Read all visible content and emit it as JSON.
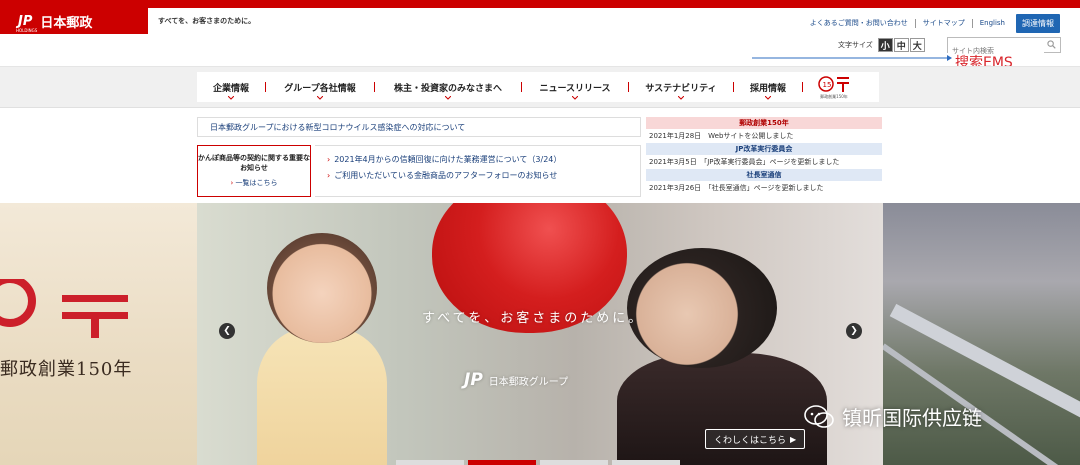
{
  "header": {
    "logo_jp": "JP",
    "logo_name": "日本郵政",
    "logo_sub": "HOLDINGS",
    "tagline": "すべてを、お客さまのために。",
    "utility_links": [
      "よくあるご質問・お問い合わせ",
      "サイトマップ",
      "English"
    ],
    "procure_label": "調達情報",
    "fontsize_label": "文字サイズ",
    "fontsize_options": [
      "小",
      "中",
      "大"
    ],
    "search_placeholder": "サイト内検索"
  },
  "annotation": {
    "text": "搜索EMS",
    "color": "#d9262c"
  },
  "nav": {
    "items": [
      "企業情報",
      "グループ各社情報",
      "株主・投資家のみなさまへ",
      "ニュースリリース",
      "サステナビリティ",
      "採用情報"
    ],
    "anniv_caption": "郵政創業150年"
  },
  "notices": {
    "covid": "日本郵政グループにおける新型コロナウイルス感染症への対応について",
    "important_title": "かんぽ商品等の契約に関する重要なお知らせ",
    "important_more": "一覧はこちら",
    "links": [
      "2021年4月からの信頼回復に向けた業務運営について（3/24）",
      "ご利用いただいている金融商品のアフターフォローのお知らせ"
    ]
  },
  "updates": {
    "sections": [
      {
        "title": "郵政創業150年",
        "style": "red",
        "rows": [
          "2021年1月28日　Webサイトを公開しました"
        ]
      },
      {
        "title": "JP改革実行委員会",
        "style": "blue",
        "rows": [
          "2021年3月5日　「JP改革実行委員会」ページを更新しました"
        ]
      },
      {
        "title": "社長室通信",
        "style": "blue",
        "rows": [
          "2021年3月26日　「社長室通信」ページを更新しました"
        ]
      }
    ]
  },
  "hero": {
    "left_text": "郵政創業150年",
    "slogan": "すべてを、お客さまのために。",
    "group_jp": "JP",
    "group_name": "日本郵政グループ",
    "more_label": "くわしくはこちら",
    "prev_arrow": "❮",
    "next_arrow": "❯"
  },
  "watermark": {
    "text": "镇昕国际供应链"
  },
  "colors": {
    "brand_red": "#cc0000",
    "link_blue": "#1a3f7a",
    "procure_blue": "#1f66b3"
  }
}
